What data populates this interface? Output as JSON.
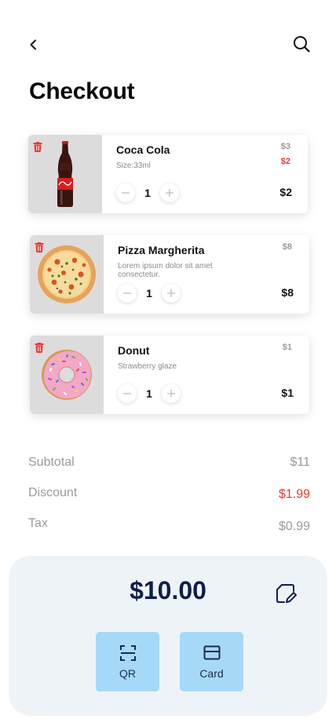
{
  "header": {
    "back_icon": "chevron-left-icon",
    "search_icon": "search-icon",
    "title": "Checkout"
  },
  "cart": {
    "items": [
      {
        "name": "Coca Cola",
        "description": "Size:33ml",
        "old_price": "$3",
        "discount_price": "$2",
        "quantity": "1",
        "price": "$2",
        "image": "coca-cola-bottle"
      },
      {
        "name": "Pizza Margherita",
        "description": "Lorem ipsum dolor sit amet consectetur.",
        "old_price": "$8",
        "discount_price": "",
        "quantity": "1",
        "price": "$8",
        "image": "pizza"
      },
      {
        "name": "Donut",
        "description": "Strawberry glaze",
        "old_price": "$1",
        "discount_price": "",
        "quantity": "1",
        "price": "$1",
        "image": "donut"
      }
    ]
  },
  "summary": {
    "subtotal_label": "Subtotal",
    "subtotal_value": "$11",
    "discount_label": "Discount",
    "discount_value": "$1.99",
    "tax_label": "Tax",
    "tax_value": "$0.99"
  },
  "payment": {
    "total": "$10.00",
    "edit_icon": "edit-note-icon",
    "qr_label": "QR",
    "card_label": "Card"
  },
  "colors": {
    "accent_red": "#e53935",
    "panel_bg": "#eef3f8",
    "button_bg": "#a6d9f7",
    "total_text": "#0f1f4a"
  }
}
